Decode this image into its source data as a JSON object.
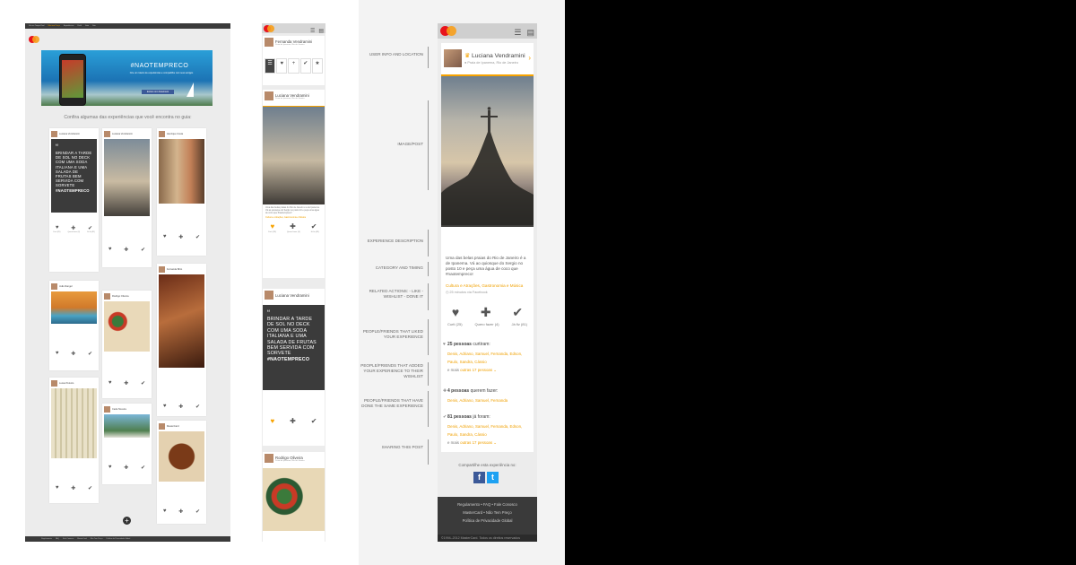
{
  "desktop": {
    "topnav": [
      "Ver em Tempo Real",
      "Não tem Preço",
      "Experiências",
      "Perfil",
      "Guia",
      "Sair"
    ],
    "hero": {
      "title": "#NAOTEMPRECO",
      "subtitle": "Crie um roteiro de experiências e compartilhe com seus amigos",
      "button": "Entrar com Facebook"
    },
    "intro": "Confira algumas das experiências que você encontra no guia:",
    "quote": "Brindar a tarde de sol no deck com uma soda italiana e uma salada de frutas bem servida com sorvete",
    "quote_tag": "#NAOTEMPRECO",
    "action_labels": [
      "Curti (25)",
      "Quero fazer (4)",
      "Já fiz (81)"
    ],
    "cards": [
      {
        "name": "Luciana Vendramini"
      },
      {
        "name": "Luciana Vendramini"
      },
      {
        "name": "Henrique Costa"
      },
      {
        "name": "Fernanda Brito"
      },
      {
        "name": "João Rangel"
      },
      {
        "name": "Rodrigo Oliveira"
      },
      {
        "name": "Lucas Peixoto"
      },
      {
        "name": "Carla Teixeira"
      },
      {
        "name": "MasterCard"
      }
    ],
    "footer": [
      "Regulamento",
      "FAQ",
      "Fale Conosco",
      "MasterCard",
      "Não Tem Preço",
      "Política de Privacidade Global"
    ]
  },
  "mobile": {
    "profile": {
      "name": "Fernanda Vendramini",
      "location": "Praia de Ipanema, Rio de Janeiro"
    },
    "stats": [
      "☰",
      "♥",
      "+",
      "✔",
      "★"
    ],
    "card1": {
      "name": "Luciana Vendramini",
      "location": "Praia de Ipanema, Rio de Janeiro",
      "text": "Uma das belas praias do Rio de Janeiro é a de Ipanema. Vá ao quiosque do Sergio no posto 10 e peça uma água de coco que #naotempreco!",
      "category": "Cultura e Atrações, Gastronomia e Música"
    },
    "card2": {
      "name": "Luciana Vendramini"
    },
    "card3": {
      "name": "Rodrigo Oliveira",
      "location": "Praia de Ipanema, Rio de Janeiro"
    },
    "action_labels": [
      "Curti (25)",
      "Quero fazer (4)",
      "Já fiz (81)"
    ]
  },
  "detail": {
    "user": {
      "name": "Luciana Vendramini",
      "location": "Praia de Ipanema, Rio de Janeiro"
    },
    "description": "Uma das belas praias do Rio de Janeiro é a de Ipanema. Vá ao quiosque do Sergio no posto 10 e peça uma água de coco que #naotempreco!",
    "category": "Cultura e Atrações, Gastronomia e Música",
    "timing": "25 minutos via Facebook",
    "actions": {
      "like": "Curti (25)",
      "wishlist": "Quero fazer (4)",
      "done": "Já fiz (81)"
    },
    "liked": {
      "count": "25 pessoas",
      "verb": "curtiram:",
      "names": "Denis, Adriano, Samuel, Fernanda, Edson, Paulo, Sandra, Cássio",
      "more": "e mais",
      "more_link": "outras 17 pessoas"
    },
    "wish": {
      "count": "4 pessoas",
      "verb": "querem fazer:",
      "names": "Denis, Adriano, Samuel, Fernanda"
    },
    "done": {
      "count": "81 pessoas",
      "verb": "já foram:",
      "names": "Denis, Adriano, Samuel, Fernanda, Edson, Paulo, Sandra, Cássio",
      "more": "e mais",
      "more_link": "outras 17 pessoas"
    },
    "share": "Compartilhe esta experiência no:",
    "footer_links": [
      "Regulamento  •  FAQ  •  Fale Conosco",
      "MasterCard  •  Não Tem Preço",
      "Política de Privacidade Global"
    ],
    "copyright": "©1994–2012 MasterCard. Todos os direitos reservados"
  },
  "annotations": {
    "user": "User info and location",
    "image": "Image/Post",
    "description": "Experience description",
    "category": "Category and timing",
    "actions": "Related actions: - like - wishlist - done it",
    "liked": "People/friends that liked your experience",
    "wishlist": "People/friends that added your experience to their wishlist",
    "done": "People/friends that have done the same experience",
    "sharing": "Sharing this post"
  },
  "colors": {
    "accent": "#f7a300",
    "dark": "#3a3a3a",
    "facebook": "#3b5998",
    "twitter": "#1da1f2"
  }
}
